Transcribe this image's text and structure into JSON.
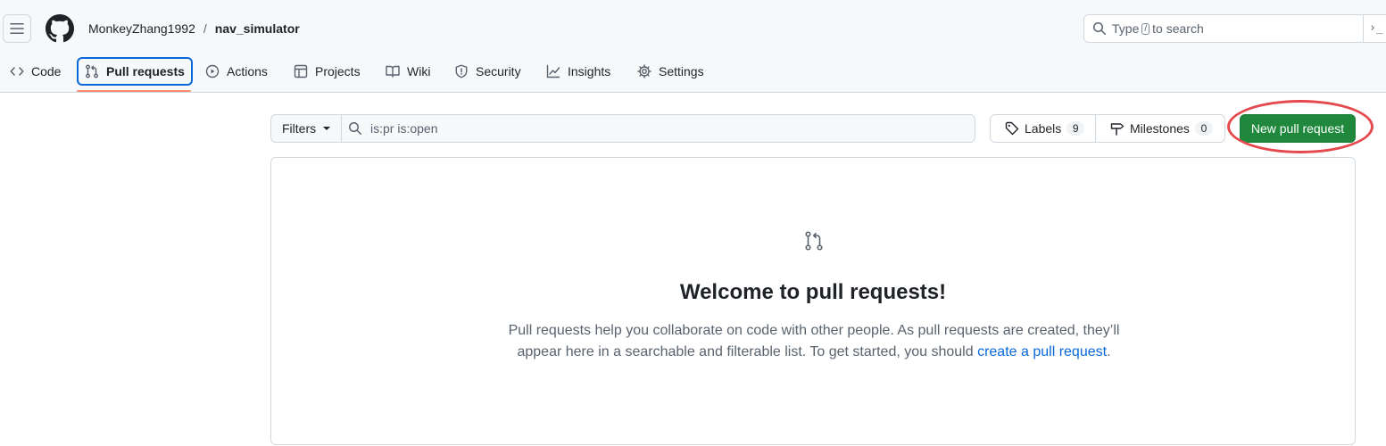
{
  "header": {
    "owner": "MonkeyZhang1992",
    "separator": "/",
    "repo": "nav_simulator",
    "search": {
      "prefix": "Type",
      "key": "/",
      "suffix": "to search"
    },
    "terminal_glyph": "›_"
  },
  "tabs": [
    {
      "label": "Code",
      "icon": "code-icon"
    },
    {
      "label": "Pull requests",
      "icon": "git-pull-request-icon",
      "selected": true
    },
    {
      "label": "Actions",
      "icon": "play-icon"
    },
    {
      "label": "Projects",
      "icon": "table-icon"
    },
    {
      "label": "Wiki",
      "icon": "book-icon"
    },
    {
      "label": "Security",
      "icon": "shield-icon"
    },
    {
      "label": "Insights",
      "icon": "graph-icon"
    },
    {
      "label": "Settings",
      "icon": "gear-icon"
    }
  ],
  "filterbar": {
    "filters_label": "Filters",
    "query": "is:pr is:open"
  },
  "labels_button": {
    "label": "Labels",
    "count": "9"
  },
  "milestones_button": {
    "label": "Milestones",
    "count": "0"
  },
  "new_pr_button": {
    "label": "New pull request"
  },
  "blankslate": {
    "title": "Welcome to pull requests!",
    "text_before": "Pull requests help you collaborate on code with other people. As pull requests are created, they’ll appear here in a searchable and filterable list. To get started, you should ",
    "link": "create a pull request",
    "text_after": "."
  },
  "colors": {
    "accent": "#0969da",
    "primary_button": "#1f883d",
    "tab_underline": "#fd8c73",
    "annotation_ring": "#e5484d"
  }
}
